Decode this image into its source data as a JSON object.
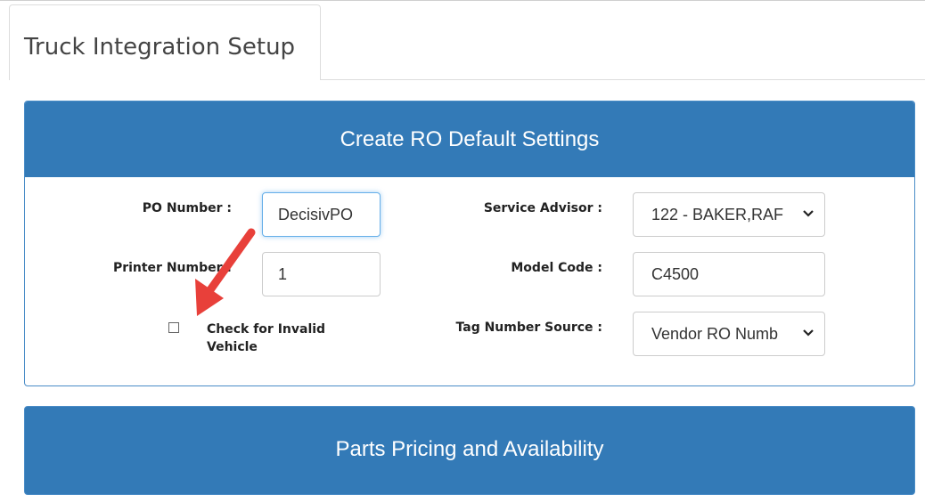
{
  "tab": {
    "title": "Truck Integration Setup"
  },
  "create_ro": {
    "heading": "Create RO Default Settings",
    "po_number_label": "PO Number :",
    "po_number_value": "DecisivPO",
    "printer_number_label": "Printer Number :",
    "printer_number_value": "1",
    "invalid_vehicle_label": "Check for Invalid Vehicle",
    "invalid_vehicle_checked": false,
    "service_advisor_label": "Service Advisor :",
    "service_advisor_value": "122 - BAKER,RAF",
    "model_code_label": "Model Code :",
    "model_code_value": "C4500",
    "tag_source_label": "Tag Number Source :",
    "tag_source_value": "Vendor RO Numb"
  },
  "parts": {
    "heading": "Parts Pricing and Availability"
  },
  "colors": {
    "panel_header": "#337ab7",
    "annotation_arrow": "#e8403a"
  }
}
